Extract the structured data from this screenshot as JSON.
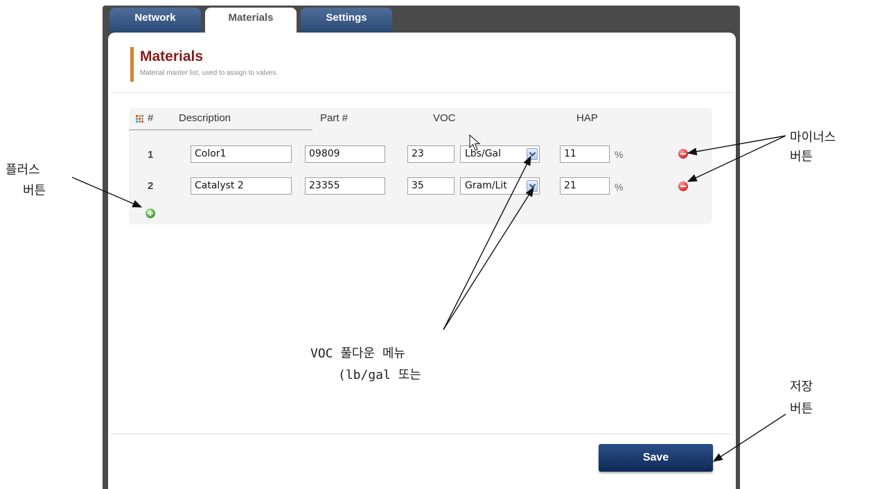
{
  "tabs": [
    {
      "label": "Network",
      "active": false
    },
    {
      "label": "Materials",
      "active": true
    },
    {
      "label": "Settings",
      "active": false
    }
  ],
  "page": {
    "title": "Materials",
    "subtitle": "Material master list, used to assign to valves."
  },
  "table": {
    "headers": {
      "number": "#",
      "description": "Description",
      "part": "Part #",
      "voc": "VOC",
      "hap": "HAP"
    },
    "rows": [
      {
        "num": "1",
        "description": "Color1",
        "part": "09809",
        "voc": "23",
        "voc_unit": "Lbs/Gal",
        "hap": "11",
        "hap_unit": "%"
      },
      {
        "num": "2",
        "description": "Catalyst 2",
        "part": "23355",
        "voc": "35",
        "voc_unit": "Gram/Lit",
        "hap": "21",
        "hap_unit": "%"
      }
    ]
  },
  "buttons": {
    "save": "Save"
  },
  "annotations": {
    "plus_line1": "플러스",
    "plus_line2": "버튼",
    "minus_line1": "마이너스",
    "minus_line2": "버튼",
    "voc_line1": "VOC 풀다운 메뉴",
    "voc_line2": "(lb/gal 또는",
    "save_line1": "저장",
    "save_line2": "버튼"
  },
  "colors": {
    "title": "#8b1a1a",
    "accent": "#d9822b",
    "tab_dark": "#2b4a75",
    "save_button": "#0f2a57",
    "minus_icon": "#d23030",
    "plus_icon": "#3f9c2e"
  },
  "icons": {
    "minus": "minus-circle-icon",
    "plus": "plus-circle-icon",
    "grid": "grid-icon",
    "dropdown": "chevron-down-icon"
  }
}
